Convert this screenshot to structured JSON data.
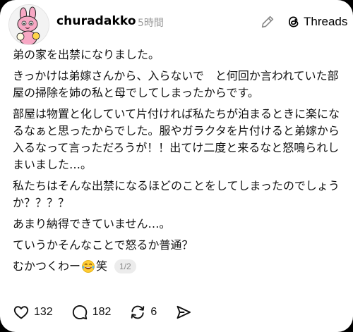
{
  "post": {
    "username": "churadakko",
    "time_ago": "5時間",
    "app_name": "Threads",
    "paragraphs": [
      "弟の家を出禁になりました。",
      "きっかけは弟嫁さんから、入らないで　と何回か言われていた部屋の掃除を姉の私と母でしてしまったからです。",
      "部屋は物置と化していて片付ければ私たちが泊まるときに楽になるなぁと思ったからでした。服やガラクタを片付けると弟嫁から　入るなって言っただろうが！！出てけ二度と来るなと怒鳴られしまいました…。",
      "私たちはそんな出禁になるほどのことをしてしまったのでしょうか？？？？",
      "あまり納得できていません…。",
      "ていうかそんなことで怒るか普通？"
    ],
    "last_line_before_emoji": "むかつくわー",
    "last_line_after_emoji": "笑",
    "page_indicator": "1/2"
  },
  "actions": {
    "likes": "132",
    "replies": "182",
    "reposts": "6"
  },
  "icons": {
    "avatar": "pink-bunny-character-avatar",
    "edit": "pencil-icon",
    "threads": "threads-logo-icon",
    "emoji": "tears-of-joy-emoji",
    "like": "heart-icon",
    "reply": "speech-bubble-icon",
    "repost": "repost-arrows-icon",
    "share": "send-arrow-icon"
  }
}
